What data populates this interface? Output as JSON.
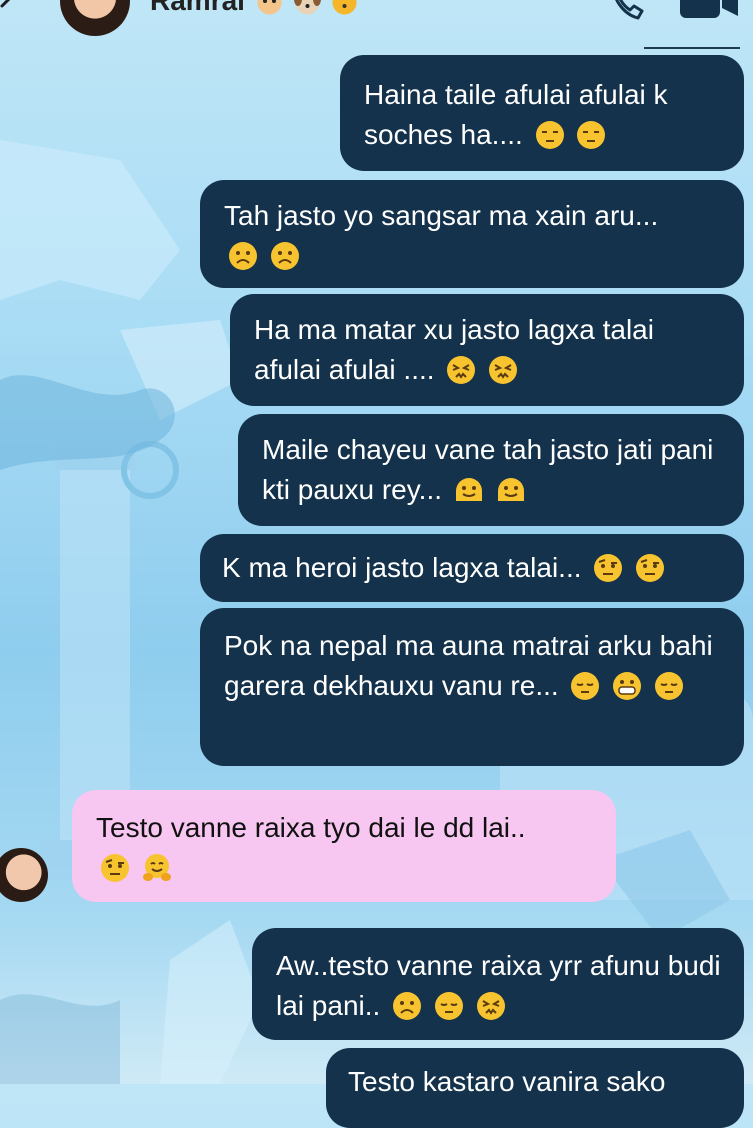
{
  "header": {
    "contact_name": "Ramrai",
    "name_emojis": [
      "hamster-emoji",
      "dog-emoji",
      "tiger-emoji"
    ],
    "icons": [
      "back-icon",
      "phone-icon",
      "video-icon"
    ]
  },
  "messages": [
    {
      "direction": "out",
      "text": "Haina taile afulai afulai k soches ha....",
      "emojis": [
        "unamused-emoji",
        "unamused-emoji"
      ]
    },
    {
      "direction": "out",
      "text": "Tah jasto yo sangsar ma xain aru...",
      "emojis": [
        "frowning-emoji",
        "frowning-emoji"
      ]
    },
    {
      "direction": "out",
      "text": "Ha ma matar xu jasto lagxa talai afulai afulai ....",
      "emojis": [
        "persevering-emoji",
        "persevering-emoji"
      ]
    },
    {
      "direction": "out",
      "text": "Maile chayeu vane tah jasto jati pani kti pauxu rey...",
      "emojis": [
        "melting-emoji",
        "melting-emoji"
      ]
    },
    {
      "direction": "out",
      "text": "K ma heroi jasto lagxa talai...",
      "emojis": [
        "raised-eyebrow-emoji",
        "raised-eyebrow-emoji"
      ]
    },
    {
      "direction": "out",
      "text": "Pok na nepal ma auna matrai arku bahi garera dekhauxu vanu re...",
      "emojis": [
        "pensive-emoji",
        "grinning-emoji",
        "pensive-emoji"
      ]
    },
    {
      "direction": "in",
      "text": "Testo vanne raixa tyo dai le dd lai..",
      "emojis": [
        "raised-eyebrow-emoji",
        "hugging-emoji"
      ]
    },
    {
      "direction": "out",
      "text": "Aw..testo vanne raixa yrr afunu budi lai pani..",
      "emojis": [
        "frowning-emoji",
        "pensive-emoji",
        "persevering-emoji"
      ]
    },
    {
      "direction": "out",
      "text": "Testo kastaro vanira sako",
      "emojis": []
    }
  ],
  "colors": {
    "outgoing_bubble": "#14324b",
    "incoming_bubble": "#f7c6f1",
    "background": "#a9dcf5"
  }
}
